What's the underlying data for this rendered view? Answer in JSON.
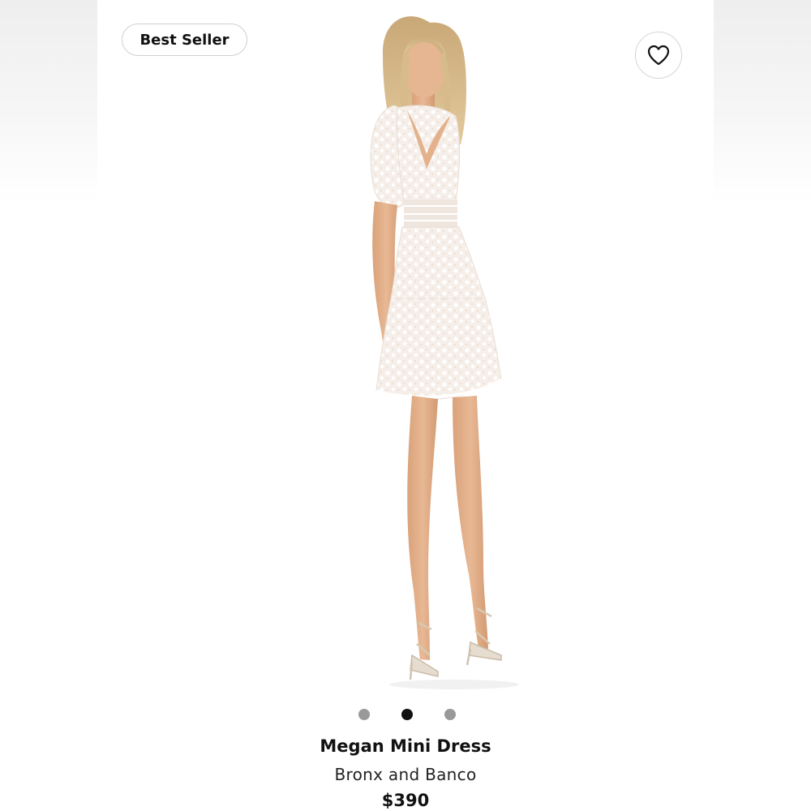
{
  "badge": {
    "label": "Best Seller"
  },
  "favorite": {
    "icon": "heart-outline-icon"
  },
  "image": {
    "subject": "product-photo-model-white-lace-mini-dress"
  },
  "carousel": {
    "count": 3,
    "active_index": 1
  },
  "product": {
    "name": "Megan Mini Dress",
    "brand": "Bronx and Banco",
    "price": "$390"
  },
  "colors": {
    "dot_inactive": "#999999",
    "dot_active": "#111111",
    "text": "#111111"
  }
}
